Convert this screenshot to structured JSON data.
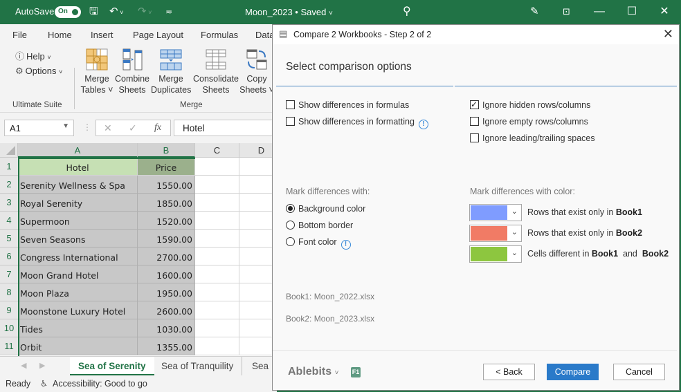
{
  "titlebar": {
    "autosave_label": "AutoSave",
    "autosave_state": "On",
    "document_title": "Moon_2023 • Saved",
    "icons": [
      "save-icon",
      "undo-icon",
      "redo-icon",
      "customize-qat-icon",
      "search-icon",
      "designer-icon",
      "ribbon-display-icon",
      "minimize-icon",
      "maximize-icon",
      "close-icon"
    ]
  },
  "ribbon": {
    "tabs": [
      "File",
      "Home",
      "Insert",
      "Page Layout",
      "Formulas",
      "Data"
    ],
    "help_label": "Help",
    "options_label": "Options",
    "group_ultimate": "Ultimate Suite",
    "group_merge": "Merge",
    "buttons": [
      {
        "line1": "Merge",
        "line2": "Tables ˅"
      },
      {
        "line1": "Combine",
        "line2": "Sheets"
      },
      {
        "line1": "Merge",
        "line2": "Duplicates"
      },
      {
        "line1": "Consolidate",
        "line2": "Sheets"
      },
      {
        "line1": "Copy",
        "line2": "Sheets ˅"
      }
    ]
  },
  "formula_bar": {
    "name_box": "A1",
    "cancel": "✕",
    "enter": "✓",
    "fx": "fx",
    "value": "Hotel"
  },
  "sheet": {
    "columns": [
      "A",
      "B",
      "C",
      "D"
    ],
    "rows": [
      {
        "n": "1",
        "a": "Hotel",
        "b": "Price"
      },
      {
        "n": "2",
        "a": "Serenity Wellness & Spa",
        "b": "1550.00"
      },
      {
        "n": "3",
        "a": "Royal Serenity",
        "b": "1850.00"
      },
      {
        "n": "4",
        "a": "Supermoon",
        "b": "1520.00"
      },
      {
        "n": "5",
        "a": "Seven Seasons",
        "b": "1590.00"
      },
      {
        "n": "6",
        "a": "Congress International",
        "b": "2700.00"
      },
      {
        "n": "7",
        "a": "Moon Grand Hotel",
        "b": "1600.00"
      },
      {
        "n": "8",
        "a": "Moon Plaza",
        "b": "1950.00"
      },
      {
        "n": "9",
        "a": "Moonstone Luxury Hotel",
        "b": "2600.00"
      },
      {
        "n": "10",
        "a": "Tides",
        "b": "1030.00"
      },
      {
        "n": "11",
        "a": "Orbit",
        "b": "1355.00"
      }
    ],
    "tabs": [
      "Sea of Serenity",
      "Sea of Tranquility",
      "Sea of"
    ],
    "active_tab": "Sea of Serenity"
  },
  "status": {
    "ready": "Ready",
    "accessibility": "Accessibility: Good to go"
  },
  "dialog": {
    "title": "Compare 2 Workbooks - Step 2 of 2",
    "heading": "Select comparison options",
    "options_left": [
      {
        "label": "Show differences in formulas",
        "checked": false,
        "info": false
      },
      {
        "label": "Show differences in formatting",
        "checked": false,
        "info": true
      }
    ],
    "options_right": [
      {
        "label": "Ignore hidden rows/columns",
        "checked": true
      },
      {
        "label": "Ignore empty rows/columns",
        "checked": false
      },
      {
        "label": "Ignore leading/trailing spaces",
        "checked": false
      }
    ],
    "mark_with_label": "Mark differences with:",
    "mark_with": [
      {
        "label": "Background color",
        "selected": true,
        "info": false
      },
      {
        "label": "Bottom border",
        "selected": false,
        "info": false
      },
      {
        "label": "Font color",
        "selected": false,
        "info": true
      }
    ],
    "mark_color_label": "Mark differences with color:",
    "colors": [
      {
        "color": "#7f9cff",
        "text": "Rows that exist only in ",
        "bold1": "Book1",
        "mid": "",
        "bold2": ""
      },
      {
        "color": "#f17b65",
        "text": "Rows that exist only in ",
        "bold1": "Book2",
        "mid": "",
        "bold2": ""
      },
      {
        "color": "#8dc63f",
        "text": "Cells different in ",
        "bold1": "Book1",
        "mid": "  and  ",
        "bold2": "Book2"
      }
    ],
    "book1": "Book1: Moon_2022.xlsx",
    "book2": "Book2: Moon_2023.xlsx",
    "brand": "Ablebits",
    "help_key": "F1",
    "back_label": "< Back",
    "compare_label": "Compare",
    "cancel_label": "Cancel"
  }
}
